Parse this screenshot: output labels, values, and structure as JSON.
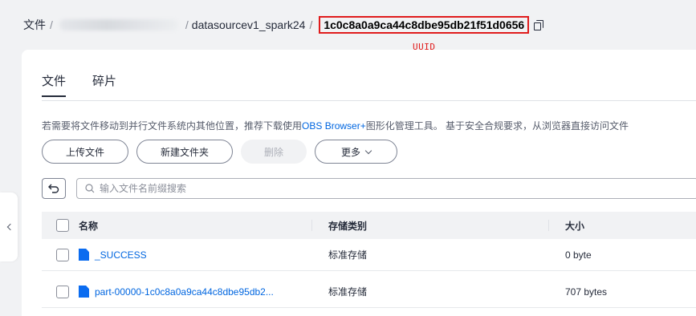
{
  "breadcrumb": {
    "root": "文件",
    "separator": "/",
    "folder": "datasourcev1_spark24",
    "current": "1c0c8a0a9ca44c8dbe95db21f51d0656"
  },
  "annotation": "UUID",
  "tabs": [
    {
      "label": "文件",
      "active": true
    },
    {
      "label": "碎片",
      "active": false
    }
  ],
  "notice": {
    "prefix": "若需要将文件移动到并行文件系统内其他位置，推荐下载使用",
    "link": "OBS Browser+",
    "suffix": "图形化管理工具。 基于安全合规要求，从浏览器直接访问文件"
  },
  "actions": {
    "upload": "上传文件",
    "new_folder": "新建文件夹",
    "delete": "删除",
    "more": "更多"
  },
  "search": {
    "placeholder": "输入文件名前缀搜索"
  },
  "table": {
    "columns": {
      "name": "名称",
      "storage": "存储类别",
      "size": "大小"
    },
    "rows": [
      {
        "name": "_SUCCESS",
        "storage": "标准存储",
        "size": "0 byte"
      },
      {
        "name": "part-00000-1c0c8a0a9ca44c8dbe95db2...",
        "storage": "标准存储",
        "size": "707 bytes"
      }
    ]
  },
  "icons": {
    "copy": "copy-icon",
    "back": "back-arrow-icon",
    "search": "search-icon",
    "collapse": "chevron-left-icon",
    "file": "file-icon"
  },
  "colors": {
    "link": "#0066e0",
    "highlight": "#e01c1c",
    "file_icon": "#0b6cf0"
  }
}
